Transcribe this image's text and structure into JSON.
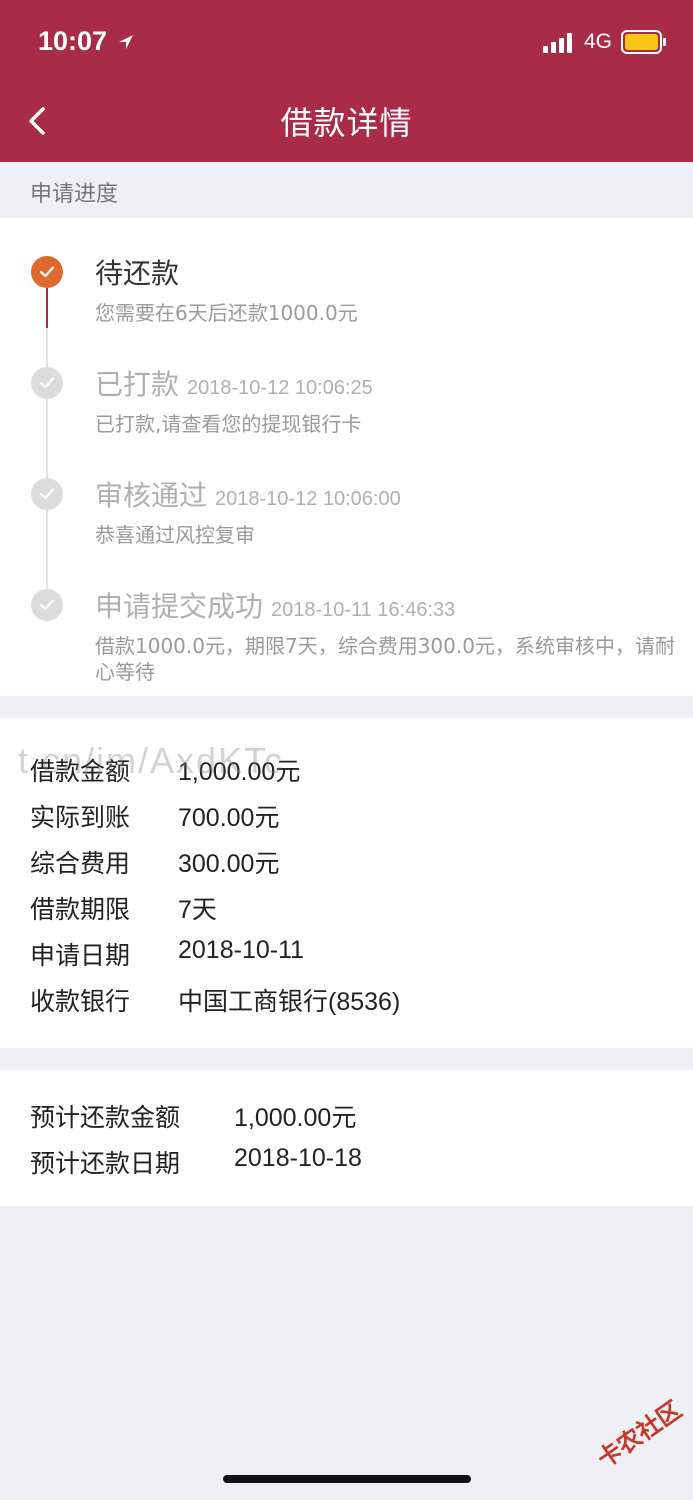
{
  "status_bar": {
    "time": "10:07",
    "network": "4G"
  },
  "header": {
    "title": "借款详情"
  },
  "progress": {
    "section_label": "申请进度",
    "steps": [
      {
        "title": "待还款",
        "time": "",
        "desc": "您需要在6天后还款1000.0元",
        "state": "active"
      },
      {
        "title": "已打款",
        "time": "2018-10-12 10:06:25",
        "desc": "已打款,请查看您的提现银行卡",
        "state": "done"
      },
      {
        "title": "审核通过",
        "time": "2018-10-12 10:06:00",
        "desc": "恭喜通过风控复审",
        "state": "done"
      },
      {
        "title": "申请提交成功",
        "time": "2018-10-11 16:46:33",
        "desc": "借款1000.0元，期限7天，综合费用300.0元，系统审核中，请耐心等待",
        "state": "done"
      }
    ]
  },
  "loan_info": {
    "rows": [
      {
        "label": "借款金额",
        "value": "1,000.00元"
      },
      {
        "label": "实际到账",
        "value": "700.00元"
      },
      {
        "label": "综合费用",
        "value": "300.00元"
      },
      {
        "label": "借款期限",
        "value": "7天"
      },
      {
        "label": "申请日期",
        "value": "2018-10-11"
      },
      {
        "label": "收款银行",
        "value": "中国工商银行(8536)"
      }
    ]
  },
  "repayment": {
    "rows": [
      {
        "label": "预计还款金额",
        "value": "1,000.00元"
      },
      {
        "label": "预计还款日期",
        "value": "2018-10-18"
      }
    ]
  },
  "watermark": "t.cn/im/AxdKTc",
  "corner_logo": "卡农社区",
  "colors": {
    "brand": "#a82c47",
    "active_step": "#e0692d",
    "done_step": "#dcdcdc"
  }
}
